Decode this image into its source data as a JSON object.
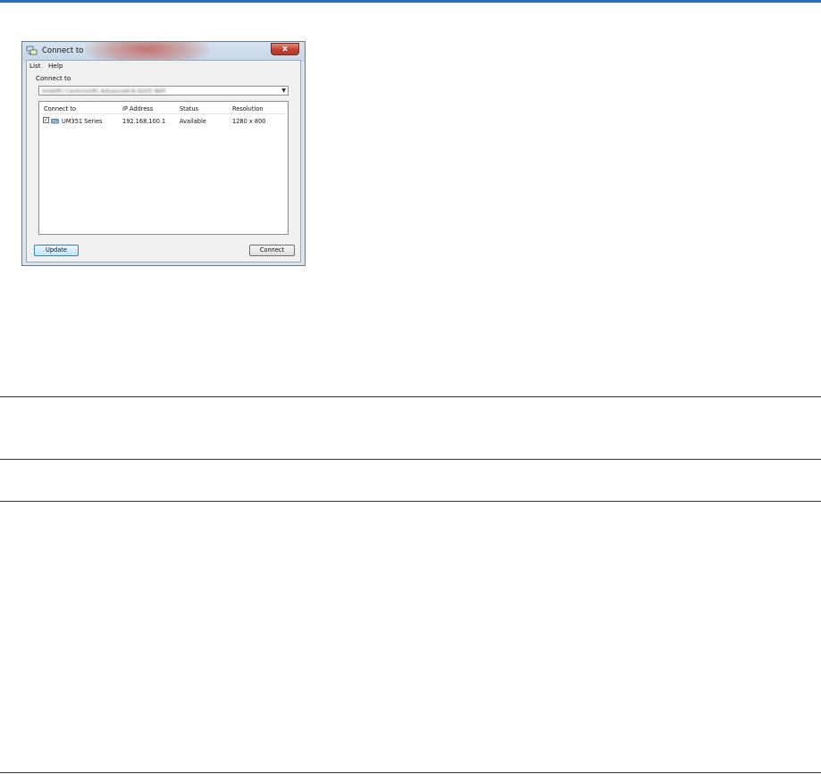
{
  "window": {
    "title": "Connect to",
    "close_label": "x"
  },
  "menu": {
    "items": [
      {
        "label": "List"
      },
      {
        "label": "Help"
      }
    ]
  },
  "form": {
    "connect_label": "Connect to",
    "combo_value": "Intel(R) Centrino(R) Advanced-N 6205 WiFi"
  },
  "table": {
    "headers": [
      "Connect to",
      "IP Address",
      "Status",
      "Resolution"
    ],
    "rows": [
      {
        "checked": true,
        "check_mark": "✓",
        "icon": "projector-icon",
        "name": "UM351 Series",
        "ip": "192.168.100.1",
        "status": "Available",
        "resolution": "1280 x 800"
      }
    ]
  },
  "buttons": {
    "update": "Update",
    "connect": "Connect"
  },
  "colors": {
    "accent_rule": "#2f6fb5",
    "close_button": "#c2412f"
  }
}
